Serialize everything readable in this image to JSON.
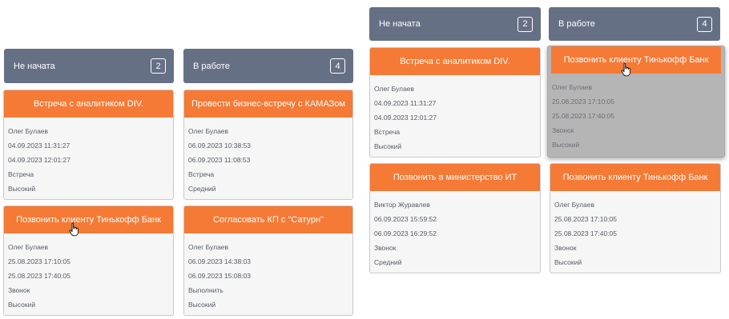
{
  "left_board": {
    "columns": [
      {
        "title": "Не начата",
        "count": "2",
        "cards": [
          {
            "title": "Встреча с аналитиком DIV.",
            "assignee": "Олег Булаев",
            "start": "04.09.2023 11:31:27",
            "end": "04.09.2023 12:01:27",
            "type": "Встреча",
            "priority": "Высокий"
          },
          {
            "title": "Позвонить клиенту Тинькофф Банк",
            "assignee": "Олег Булаев",
            "start": "25.08.2023 17:10:05",
            "end": "25.08.2023 17:40:05",
            "type": "Звонок",
            "priority": "Высокий"
          }
        ]
      },
      {
        "title": "В работе",
        "count": "4",
        "cards": [
          {
            "title": "Провести бизнес-встречу с КАМАЗом",
            "assignee": "Олег Булаев",
            "start": "06.09.2023 10:38:53",
            "end": "06.09.2023 11:08:53",
            "type": "Встреча",
            "priority": "Средний"
          },
          {
            "title": "Согласовать КП с \"Сатурн\"",
            "assignee": "Олег Булаев",
            "start": "06.09.2023 14:38:03",
            "end": "06.09.2023 15:08:03",
            "type": "Выполнить",
            "priority": "Высокий"
          }
        ]
      }
    ]
  },
  "right_board": {
    "columns": [
      {
        "title": "Не начата",
        "count": "2",
        "cards": [
          {
            "title": "Встреча с аналитиком DIV.",
            "assignee": "Олег Булаев",
            "start": "04.09.2023 11:31:27",
            "end": "04.09.2023 12:01:27",
            "type": "Встреча",
            "priority": "Высокий"
          },
          {
            "title": "Позвонить в министерство ИТ",
            "assignee": "Виктор Журавлев",
            "start": "06.09.2023 15:59:52",
            "end": "06.09.2023 16:29:52",
            "type": "Звонок",
            "priority": "Средний"
          }
        ]
      },
      {
        "title": "В работе",
        "count": "4",
        "cards": [
          {
            "title": "Позвонить клиенту Тинькофф Банк",
            "assignee": "Олег Булаев",
            "start": "25.08.2023 17:10:05",
            "end": "25.08.2023 17:40:05",
            "type": "Звонок",
            "priority": "Высокий"
          },
          {
            "title": "Позвонить клиенту Тинькофф Банк",
            "assignee": "Олег Булаев",
            "start": "25.08.2023 17:10:05",
            "end": "25.08.2023 17:40:05",
            "type": "Звонок",
            "priority": "Высокий"
          }
        ]
      }
    ]
  },
  "colors": {
    "header_bg": "#667085",
    "card_title_bg": "#f47a36",
    "card_bg": "#f6f6f6",
    "dragged_card_bg": "#b5b5b5"
  },
  "icons": {
    "cursor": "hand-pointer-icon"
  }
}
